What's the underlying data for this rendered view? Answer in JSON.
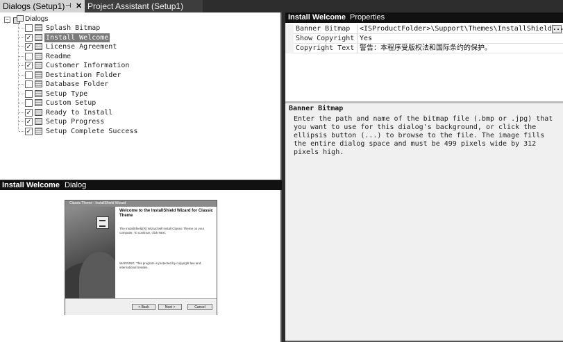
{
  "tabs": [
    {
      "label": "Dialogs (Setup1)",
      "active": true
    },
    {
      "label": "Project Assistant (Setup1)",
      "active": false
    }
  ],
  "tab_icons": {
    "pin": "pin-icon",
    "close": "close-icon"
  },
  "tree": {
    "root_label": "Dialogs",
    "root_expander": "−",
    "items": [
      {
        "label": "Splash Bitmap",
        "checked": false
      },
      {
        "label": "Install Welcome",
        "checked": true,
        "selected": true
      },
      {
        "label": "License Agreement",
        "checked": true
      },
      {
        "label": "Readme",
        "checked": false
      },
      {
        "label": "Customer Information",
        "checked": true
      },
      {
        "label": "Destination Folder",
        "checked": false
      },
      {
        "label": "Database Folder",
        "checked": false
      },
      {
        "label": "Setup Type",
        "checked": false
      },
      {
        "label": "Custom Setup",
        "checked": false
      },
      {
        "label": "Ready to Install",
        "checked": true
      },
      {
        "label": "Setup Progress",
        "checked": true
      },
      {
        "label": "Setup Complete Success",
        "checked": true
      }
    ]
  },
  "preview": {
    "header_title": "Install Welcome",
    "header_subtitle": "Dialog",
    "wizard": {
      "title": "Classic Theme - InstallShield Wizard",
      "heading": "Welcome to the InstallShield Wizard for Classic Theme",
      "intro": "The InstallShield(R) Wizard will install Classic Theme on your computer. To continue, click Next.",
      "warning": "WARNING: This program is protected by copyright law and international treaties.",
      "back_label": "< Back",
      "next_label": "Next >",
      "cancel_label": "Cancel"
    }
  },
  "properties": {
    "header_title": "Install Welcome",
    "header_subtitle": "Properties",
    "rows": [
      {
        "name": "Banner Bitmap",
        "value": "<ISProductFolder>\\Support\\Themes\\InstallShield Blue Th"
      },
      {
        "name": "Show Copyright",
        "value": "Yes"
      },
      {
        "name": "Copyright Text",
        "value": "警告：本程序受版权法和国际条约的保护。"
      }
    ],
    "ellipsis_label": "...",
    "description_title": "Banner Bitmap",
    "description_text": "Enter the path and name of the bitmap file (.bmp or .jpg) that you want to use for this dialog's background, or click the ellipsis button (...) to browse to the file. The image fills the entire dialog space and must be 499 pixels wide by 312 pixels high."
  }
}
